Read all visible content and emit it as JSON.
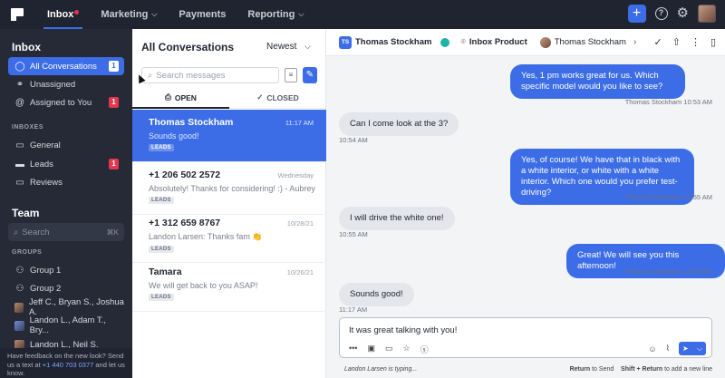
{
  "topbar": {
    "nav": [
      {
        "label": "Inbox",
        "active": true,
        "chevron": false
      },
      {
        "label": "Marketing",
        "active": false,
        "chevron": true
      },
      {
        "label": "Payments",
        "active": false,
        "chevron": false
      },
      {
        "label": "Reporting",
        "active": false,
        "chevron": true
      }
    ],
    "plus": "+",
    "help": "?",
    "gear": "⚙"
  },
  "sidebar": {
    "inbox_title": "Inbox",
    "items": [
      {
        "label": "All Conversations",
        "badge": "1"
      },
      {
        "label": "Unassigned"
      },
      {
        "label": "Assigned to You",
        "badge": "1"
      }
    ],
    "inboxes_label": "INBOXES",
    "inboxes": [
      {
        "label": "General"
      },
      {
        "label": "Leads",
        "badge": "1"
      },
      {
        "label": "Reviews"
      }
    ],
    "team_title": "Team",
    "search_placeholder": "Search",
    "search_shortcut": "⌘K",
    "groups_label": "GROUPS",
    "groups": [
      {
        "label": "Group 1"
      },
      {
        "label": "Group 2"
      },
      {
        "label": "Jeff C., Bryan S., Joshua A."
      },
      {
        "label": "Landon L., Adam T., Bry..."
      },
      {
        "label": "Landon L., Neil S."
      }
    ],
    "feedback": {
      "text1": "Have feedback on the new look? Send us a text at ",
      "phone": "+1 440 703 0377",
      "text2": " and let us know."
    }
  },
  "list": {
    "title": "All Conversations",
    "sort": "Newest",
    "search_placeholder": "Search messages",
    "tabs": [
      {
        "label": "OPEN",
        "icon": "inbox-icon"
      },
      {
        "label": "CLOSED",
        "icon": "check-icon"
      }
    ],
    "conversations": [
      {
        "name": "Thomas Stockham",
        "time": "11:17 AM",
        "preview": "Sounds good!",
        "tag": "LEADS",
        "active": true
      },
      {
        "name": "+1 206 502 2572",
        "time": "Wednesday",
        "preview": "Absolutely! Thanks for considering! :) - Aubrey",
        "tag": "LEADS"
      },
      {
        "name": "+1 312 659 8767",
        "time": "10/28/21",
        "preview": "Landon Larsen: Thanks fam 👏",
        "tag": "LEADS"
      },
      {
        "name": "Tamara",
        "time": "10/26/21",
        "preview": "We will get back to you ASAP!",
        "tag": "LEADS"
      }
    ]
  },
  "chat": {
    "header": {
      "initials": "TS",
      "name": "Thomas Stockham",
      "inbox": "Inbox Product",
      "assignee": "Thomas Stockham"
    },
    "messages": [
      {
        "dir": "out",
        "text": "Yes, 1 pm works great for us. Which specific model would you like to see?",
        "meta": "Thomas Stockham 10:53 AM"
      },
      {
        "dir": "in",
        "text": "Can I come look at the 3?",
        "meta": "10:54 AM"
      },
      {
        "dir": "out",
        "text": "Yes, of course! We have that in black with a white interior, or white with a white interior. Which one would you prefer test-driving?",
        "meta": "Thomas Stockham 10:55 AM"
      },
      {
        "dir": "in",
        "text": "I will drive the white one!",
        "meta": "10:55 AM"
      },
      {
        "dir": "out",
        "text": "Great! We will see you this afternoon!",
        "meta": "Thomas Stockham 10:58 AM"
      },
      {
        "dir": "in",
        "text": "Sounds good!",
        "meta": "11:17 AM"
      }
    ],
    "composer_text": "It was great talking with you!",
    "typing": "Landon Larsen is typing...",
    "hint_key1": "Return",
    "hint_text1": " to Send",
    "hint_key2": "Shift + Return",
    "hint_text2": " to add a new line"
  }
}
